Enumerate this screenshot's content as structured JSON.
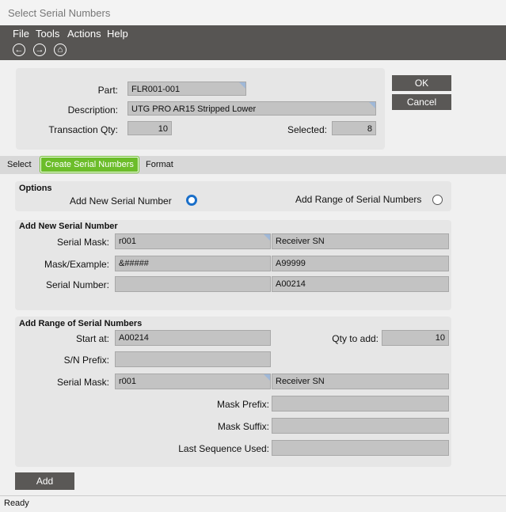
{
  "window": {
    "title": "Select Serial Numbers"
  },
  "menu": [
    "File",
    "Tools",
    "Actions",
    "Help"
  ],
  "toolbar": {
    "back": "←",
    "forward": "→",
    "home": "⌂"
  },
  "header": {
    "part_label": "Part:",
    "part": "FLR001-001",
    "desc_label": "Description:",
    "desc": "UTG PRO AR15 Stripped Lower",
    "qty_label": "Transaction Qty:",
    "qty": "10",
    "selected_label": "Selected:",
    "selected": "8"
  },
  "buttons": {
    "ok": "OK",
    "cancel": "Cancel",
    "add": "Add"
  },
  "tabs": [
    "Select",
    "Create Serial Numbers",
    "Format"
  ],
  "options": {
    "title": "Options",
    "new": "Add New Serial Number",
    "range": "Add Range of Serial Numbers",
    "selected": "new"
  },
  "add_new": {
    "title": "Add New Serial Number",
    "mask_label": "Serial Mask:",
    "mask": "r001",
    "mask_desc": "Receiver SN",
    "example_label": "Mask/Example:",
    "mask_pattern": "&#####",
    "example": "A99999",
    "sn_label": "Serial Number:",
    "sn": "",
    "sn_value": "A00214"
  },
  "add_range": {
    "title": "Add Range of Serial Numbers",
    "start_label": "Start at:",
    "start": "A00214",
    "qty_label": "Qty to add:",
    "qty": "10",
    "prefix_label": "S/N Prefix:",
    "prefix": "",
    "mask_label": "Serial Mask:",
    "mask": "r001",
    "mask_desc": "Receiver SN",
    "mprefix_label": "Mask Prefix:",
    "mprefix": "",
    "msuffix_label": "Mask Suffix:",
    "msuffix": "",
    "last_label": "Last Sequence Used:",
    "last": ""
  },
  "status": "Ready"
}
